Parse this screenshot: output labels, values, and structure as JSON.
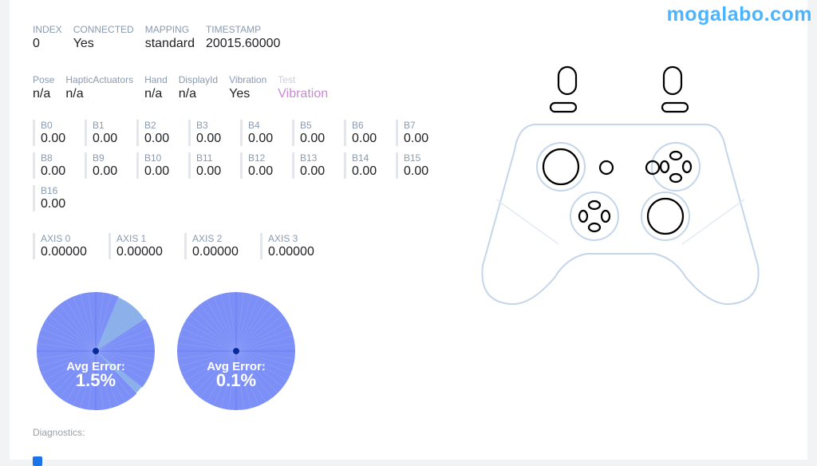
{
  "watermark": "mogalabo.com",
  "info_row1": [
    {
      "label": "INDEX",
      "value": "0"
    },
    {
      "label": "CONNECTED",
      "value": "Yes"
    },
    {
      "label": "MAPPING",
      "value": "standard"
    },
    {
      "label": "TIMESTAMP",
      "value": "20015.60000"
    }
  ],
  "info_row2": [
    {
      "label": "Pose",
      "value": "n/a"
    },
    {
      "label": "HapticActuators",
      "value": "n/a"
    },
    {
      "label": "Hand",
      "value": "n/a"
    },
    {
      "label": "DisplayId",
      "value": "n/a"
    },
    {
      "label": "Vibration",
      "value": "Yes"
    },
    {
      "label": "Test",
      "value": "Vibration"
    }
  ],
  "buttons": [
    {
      "label": "B0",
      "value": "0.00"
    },
    {
      "label": "B1",
      "value": "0.00"
    },
    {
      "label": "B2",
      "value": "0.00"
    },
    {
      "label": "B3",
      "value": "0.00"
    },
    {
      "label": "B4",
      "value": "0.00"
    },
    {
      "label": "B5",
      "value": "0.00"
    },
    {
      "label": "B6",
      "value": "0.00"
    },
    {
      "label": "B7",
      "value": "0.00"
    },
    {
      "label": "B8",
      "value": "0.00"
    },
    {
      "label": "B9",
      "value": "0.00"
    },
    {
      "label": "B10",
      "value": "0.00"
    },
    {
      "label": "B11",
      "value": "0.00"
    },
    {
      "label": "B12",
      "value": "0.00"
    },
    {
      "label": "B13",
      "value": "0.00"
    },
    {
      "label": "B14",
      "value": "0.00"
    },
    {
      "label": "B15",
      "value": "0.00"
    },
    {
      "label": "B16",
      "value": "0.00"
    }
  ],
  "axes": [
    {
      "label": "AXIS 0",
      "value": "0.00000"
    },
    {
      "label": "AXIS 1",
      "value": "0.00000"
    },
    {
      "label": "AXIS 2",
      "value": "0.00000"
    },
    {
      "label": "AXIS 3",
      "value": "0.00000"
    }
  ],
  "circularity": [
    {
      "label": "Avg Error:",
      "value": "1.5%"
    },
    {
      "label": "Avg Error:",
      "value": "0.1%"
    }
  ],
  "diagnostics_label": "Diagnostics:",
  "colors": {
    "circle": "#7b8ff7",
    "center_dot": "#0b2a9e",
    "controller_outline": "#c5d5ea",
    "test_link": "#c98ad6",
    "watermark": "#49b4ff"
  }
}
